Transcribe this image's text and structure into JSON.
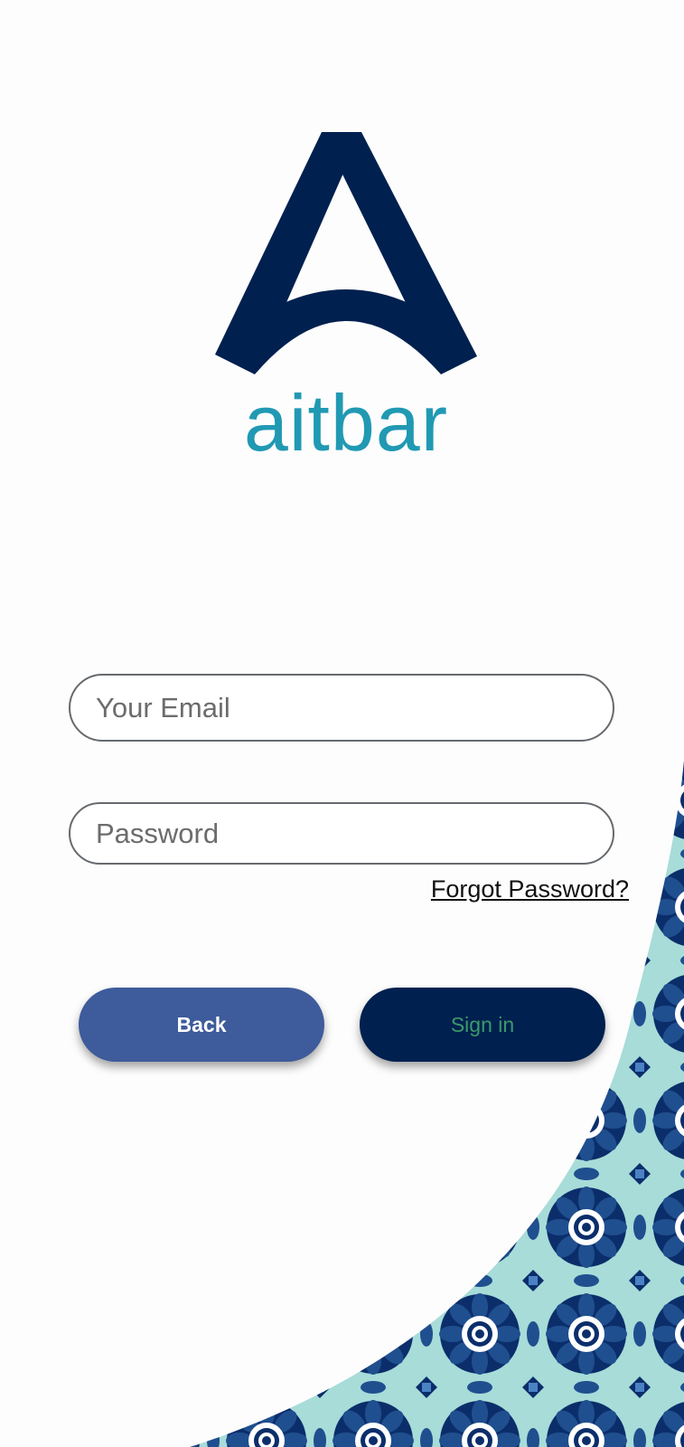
{
  "brand": {
    "name": "aitbar",
    "primary_color": "#00204f",
    "accent_color": "#2199b3"
  },
  "login_form": {
    "email_placeholder": "Your Email",
    "email_value": "",
    "password_placeholder": "Password",
    "password_value": "",
    "forgot_password_label": "Forgot Password?"
  },
  "actions": {
    "back_label": "Back",
    "back_color": "#3e5b9b",
    "signin_label": "Sign in",
    "signin_color": "#00204f",
    "signin_text_color": "#3b9a6a"
  },
  "decoration": {
    "pattern_colors": [
      "#0b2e6b",
      "#1f4f8f",
      "#4a82c4",
      "#a7dcd8",
      "#ffffff"
    ]
  }
}
